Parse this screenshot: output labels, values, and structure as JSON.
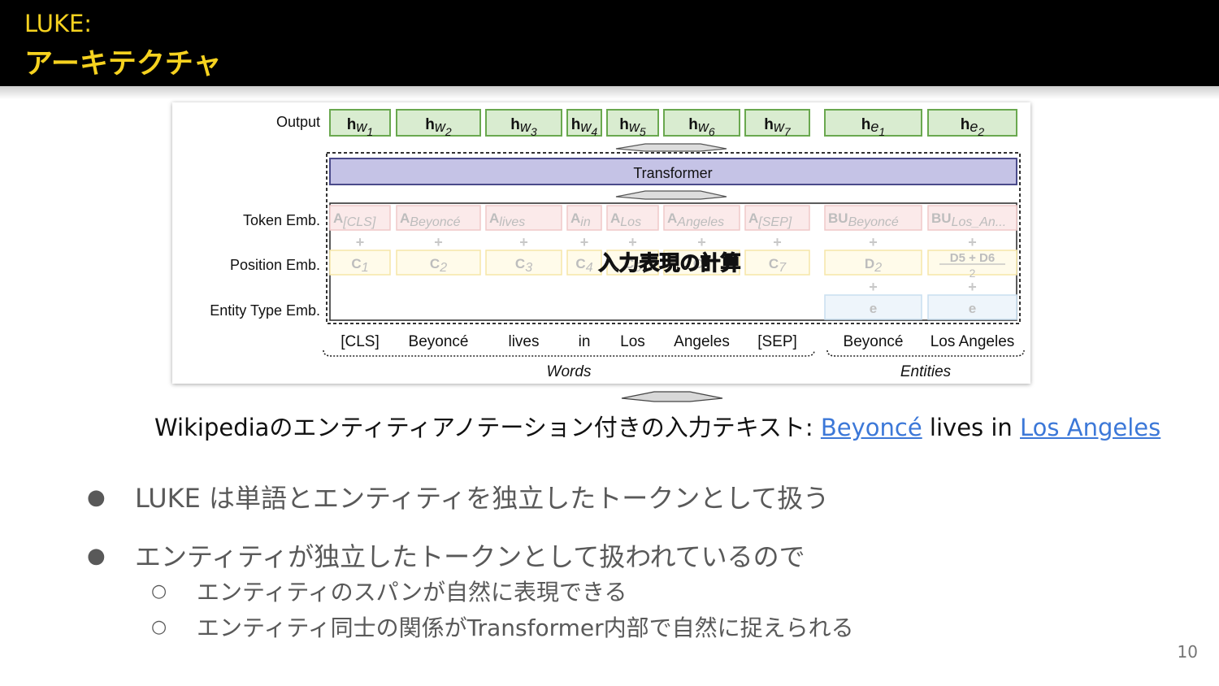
{
  "header": {
    "title_line1": "LUKE:",
    "title_line2": "アーキテクチャ"
  },
  "figure": {
    "row_labels": {
      "output": "Output",
      "token": "Token Emb.",
      "position": "Position Emb.",
      "entity_type": "Entity Type Emb."
    },
    "transformer_label": "Transformer",
    "overlay_text": "入力表現の計算",
    "output_tokens": [
      {
        "base": "h",
        "sub": "w",
        "idx": "1"
      },
      {
        "base": "h",
        "sub": "w",
        "idx": "2"
      },
      {
        "base": "h",
        "sub": "w",
        "idx": "3"
      },
      {
        "base": "h",
        "sub": "w",
        "idx": "4"
      },
      {
        "base": "h",
        "sub": "w",
        "idx": "5"
      },
      {
        "base": "h",
        "sub": "w",
        "idx": "6"
      },
      {
        "base": "h",
        "sub": "w",
        "idx": "7"
      },
      {
        "base": "h",
        "sub": "e",
        "idx": "1"
      },
      {
        "base": "h",
        "sub": "e",
        "idx": "2"
      }
    ],
    "token_emb": [
      {
        "base": "A",
        "sub": "[CLS]"
      },
      {
        "base": "A",
        "sub": "Beyoncé"
      },
      {
        "base": "A",
        "sub": "lives"
      },
      {
        "base": "A",
        "sub": "in"
      },
      {
        "base": "A",
        "sub": "Los"
      },
      {
        "base": "A",
        "sub": "Angeles"
      },
      {
        "base": "A",
        "sub": "[SEP]"
      },
      {
        "base": "BU",
        "sub": "Beyoncé"
      },
      {
        "base": "BU",
        "sub": "Los_An..."
      }
    ],
    "position_emb": [
      {
        "base": "C",
        "sub": "1"
      },
      {
        "base": "C",
        "sub": "2"
      },
      {
        "base": "C",
        "sub": "3"
      },
      {
        "base": "C",
        "sub": "4"
      },
      {
        "base": "C",
        "sub": "5"
      },
      {
        "base": "C",
        "sub": "6"
      },
      {
        "base": "C",
        "sub": "7"
      },
      {
        "base": "D",
        "sub": "2"
      }
    ],
    "position_fraction": {
      "numerator": "D5 + D6",
      "denominator": "2"
    },
    "entity_type_emb": [
      "e",
      "e"
    ],
    "plus": "+",
    "words": [
      "[CLS]",
      "Beyoncé",
      "lives",
      "in",
      "Los",
      "Angeles",
      "[SEP]"
    ],
    "entities": [
      "Beyoncé",
      "Los Angeles"
    ],
    "group_words": "Words",
    "group_entities": "Entities",
    "colors": {
      "output_fill": "#d9ecd0",
      "output_stroke": "#6aa84f",
      "transformer_fill": "#c5c3e6",
      "transformer_stroke": "#4a4a8a",
      "token_fill": "#fbeaea",
      "position_fill": "#fffbea",
      "entity_fill": "#eef5fb"
    }
  },
  "caption": {
    "prefix": "Wikipediaのエンティティアノテーション付きの入力テキスト: ",
    "entity1": "Beyoncé",
    "middle": " lives in ",
    "entity2": "Los Angeles"
  },
  "bullets": [
    "LUKE は単語とエンティティを独立したトークンとして扱う",
    "エンティティが独立したトークンとして扱われているので"
  ],
  "sub_bullets": [
    "エンティティのスパンが自然に表現できる",
    "エンティティ同士の関係がTransformer内部で自然に捉えられる"
  ],
  "bullet_symbol": "●",
  "sub_bullet_symbol": "○",
  "page_number": "10"
}
